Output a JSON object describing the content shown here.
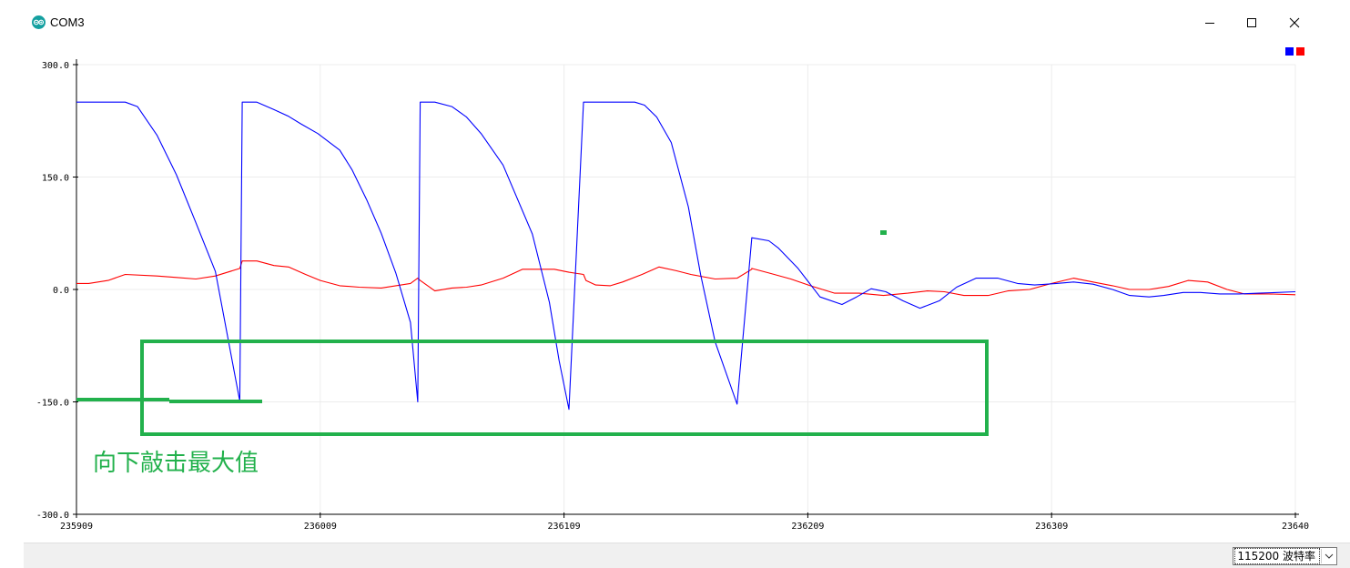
{
  "window": {
    "title": "COM3",
    "icon": "arduino-icon",
    "controls": [
      "minimize-icon",
      "maximize-icon",
      "close-icon"
    ]
  },
  "legend": {
    "colors": [
      "#0000ff",
      "#ff0000"
    ]
  },
  "annotation": {
    "text": "向下敲击最大值",
    "color": "#22b14c"
  },
  "bottom_bar": {
    "baud_rate": "115200 波特率"
  },
  "chart_data": {
    "type": "line",
    "y_ticks": [
      "300.0",
      "150.0",
      "0.0",
      "-150.0",
      "-300.0"
    ],
    "x_ticks": [
      "235909",
      "236009",
      "236109",
      "236209",
      "236309",
      "23640"
    ],
    "ylim": [
      -300,
      300
    ],
    "xlim": [
      235909,
      236409
    ],
    "grid": true,
    "legend_placement": "top-right",
    "series": [
      {
        "color": "#0000ff",
        "x": [
          235909,
          235929,
          235934,
          235942,
          235950,
          235958,
          235966,
          235976,
          235977,
          235983,
          235990,
          235996,
          236001,
          236008,
          236017,
          236022,
          236028,
          236034,
          236040,
          236046,
          236049,
          236050,
          236056,
          236063,
          236069,
          236075,
          236084,
          236096,
          236103,
          236107,
          236111,
          236117,
          236118,
          236122,
          236130,
          236138,
          236142,
          236147,
          236153,
          236160,
          236165,
          236171,
          236180,
          236186,
          236186,
          236193,
          236197,
          236205,
          236214,
          236223,
          236229,
          236235,
          236241,
          236248,
          236255,
          236263,
          236270,
          236278,
          236287,
          236295,
          236302,
          236311,
          236318,
          236326,
          236334,
          236341,
          236349,
          236355,
          236363,
          236370,
          236378,
          236386,
          236394,
          236409
        ],
        "y": [
          250,
          250,
          244,
          206,
          153,
          89,
          24,
          -149,
          250,
          250,
          240,
          231,
          221,
          208,
          186,
          160,
          120,
          75,
          22,
          -44,
          -150,
          250,
          250,
          244,
          230,
          208,
          166,
          74,
          -17,
          -95,
          -160,
          250,
          250,
          250,
          250,
          250,
          246,
          230,
          196,
          110,
          20,
          -70,
          -153,
          68,
          69,
          65,
          55,
          28,
          -10,
          -20,
          -10,
          1,
          -3,
          -15,
          -25,
          -15,
          3,
          15,
          15,
          8,
          6,
          8,
          10,
          7,
          0,
          -8,
          -10,
          -8,
          -4,
          -4,
          -6,
          -6,
          -5,
          -3
        ]
      },
      {
        "color": "#ff0000",
        "x": [
          235909,
          235914,
          235922,
          235929,
          235942,
          235950,
          235958,
          235966,
          235976,
          235977,
          235983,
          235990,
          235996,
          236003,
          236009,
          236017,
          236025,
          236034,
          236040,
          236046,
          236049,
          236050,
          236056,
          236063,
          236069,
          236075,
          236084,
          236092,
          236099,
          236105,
          236111,
          236117,
          236118,
          236122,
          236128,
          236133,
          236141,
          236148,
          236155,
          236161,
          236166,
          236171,
          236180,
          236186,
          236186,
          236193,
          236202,
          236210,
          236220,
          236230,
          236240,
          236250,
          236258,
          236265,
          236273,
          236283,
          236291,
          236300,
          236309,
          236318,
          236326,
          236334,
          236341,
          236349,
          236357,
          236365,
          236373,
          236381,
          236388,
          236398,
          236409
        ],
        "y": [
          8,
          8,
          12,
          20,
          18,
          16,
          14,
          18,
          28,
          38,
          38,
          32,
          30,
          20,
          12,
          5,
          3,
          2,
          5,
          8,
          15,
          12,
          -2,
          2,
          3,
          6,
          15,
          27,
          27,
          27,
          23,
          20,
          12,
          6,
          5,
          10,
          20,
          30,
          25,
          20,
          17,
          14,
          15,
          27,
          28,
          22,
          14,
          5,
          -5,
          -5,
          -8,
          -5,
          -2,
          -3,
          -8,
          -8,
          -2,
          0,
          8,
          15,
          10,
          5,
          0,
          0,
          4,
          12,
          10,
          0,
          -6,
          -6,
          -7
        ]
      }
    ]
  }
}
